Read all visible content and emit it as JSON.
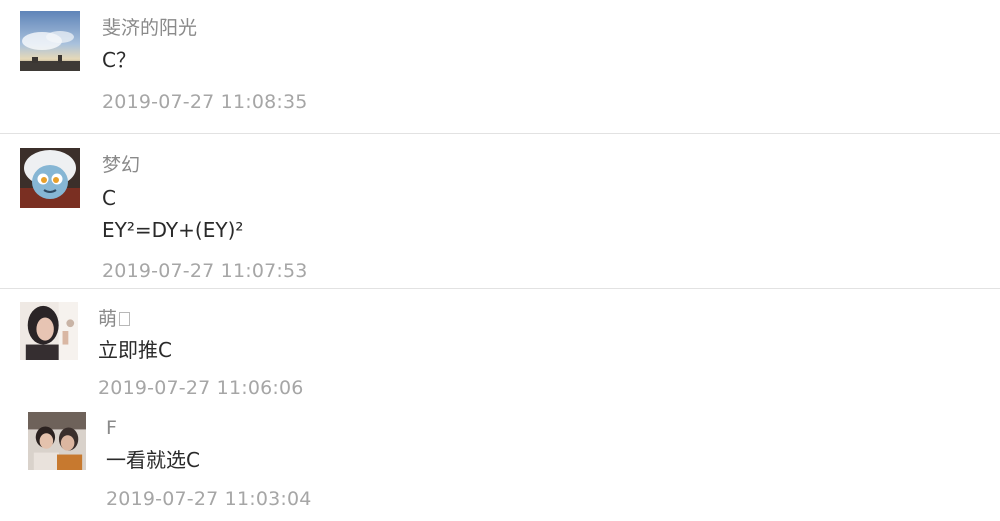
{
  "comments": [
    {
      "user": "斐济的阳光",
      "lines": [
        "C？"
      ],
      "time": "2019-07-27 11:08:35",
      "avatar": "sky-landscape-avatar"
    },
    {
      "user": "梦幻",
      "lines": [
        "C",
        "EY²=DY+(EY)²"
      ],
      "time": "2019-07-27 11:07:53",
      "avatar": "cartoon-character-avatar"
    },
    {
      "user": "萌",
      "lines": [
        "立即推C"
      ],
      "time": "2019-07-27 11:06:06",
      "avatar": "portrait-photo-avatar"
    }
  ],
  "reply": {
    "user": "F",
    "lines": [
      "一看就选C"
    ],
    "time": "2019-07-27 11:03:04",
    "avatar": "people-photo-avatar"
  },
  "colors": {
    "username": "#8a8a8a",
    "text": "#2a2a2a",
    "timestamp": "#a6a6a6",
    "divider": "#e2e2e2"
  }
}
